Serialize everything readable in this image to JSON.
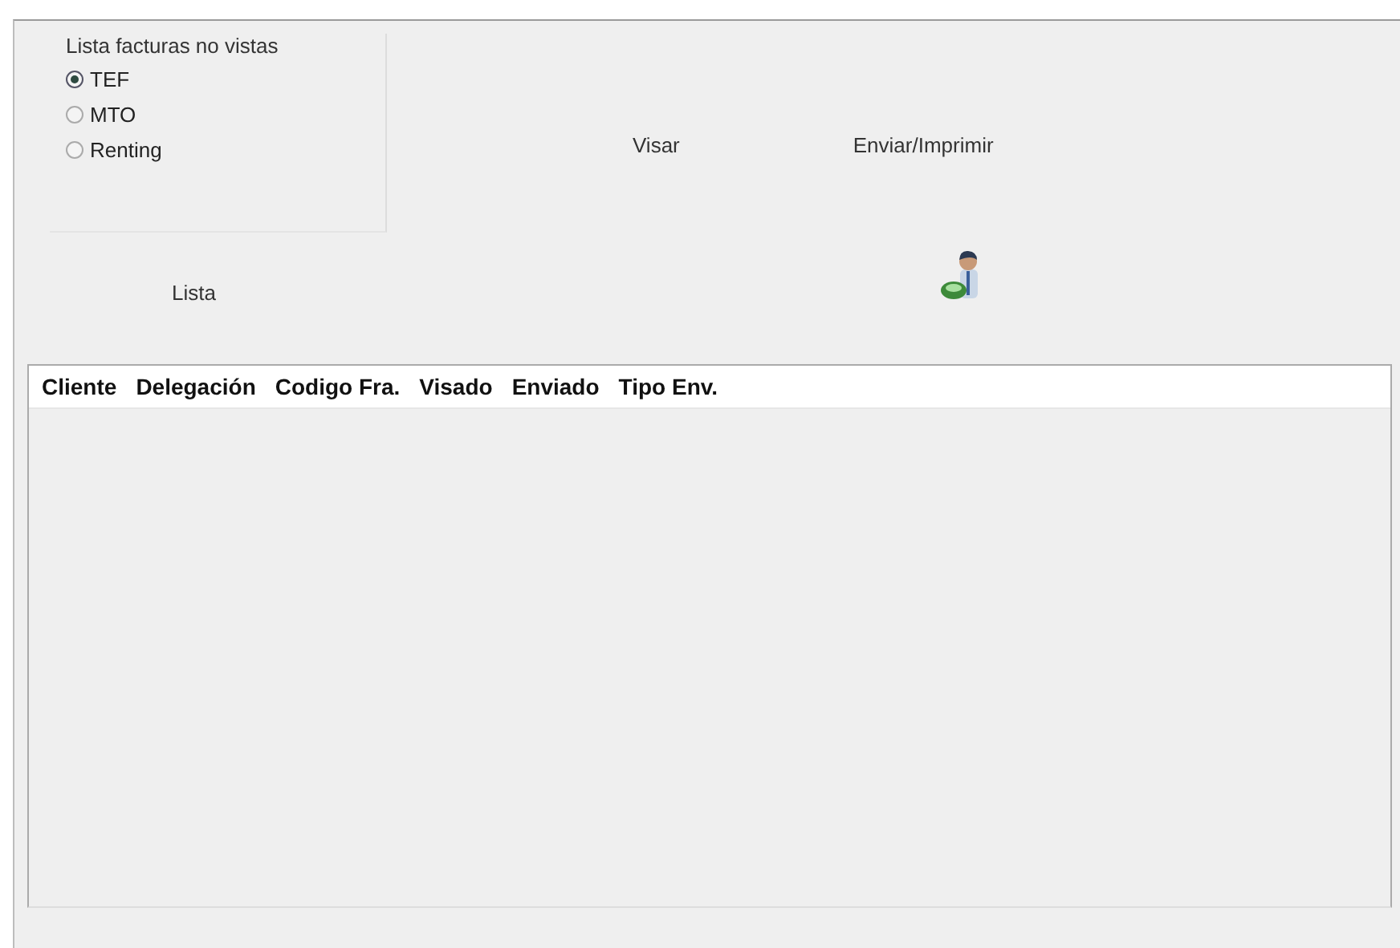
{
  "filter_group": {
    "title": "Lista facturas no vistas",
    "options": [
      {
        "label": "TEF",
        "selected": true
      },
      {
        "label": "MTO",
        "selected": false
      },
      {
        "label": "Renting",
        "selected": false
      }
    ]
  },
  "buttons": {
    "list": "Lista",
    "approve": "Visar",
    "send": "Enviar/Imprimir"
  },
  "table": {
    "columns": [
      "Cliente",
      "Delegación",
      "Codigo Fra.",
      "Visado",
      "Enviado",
      "Tipo Env."
    ]
  }
}
